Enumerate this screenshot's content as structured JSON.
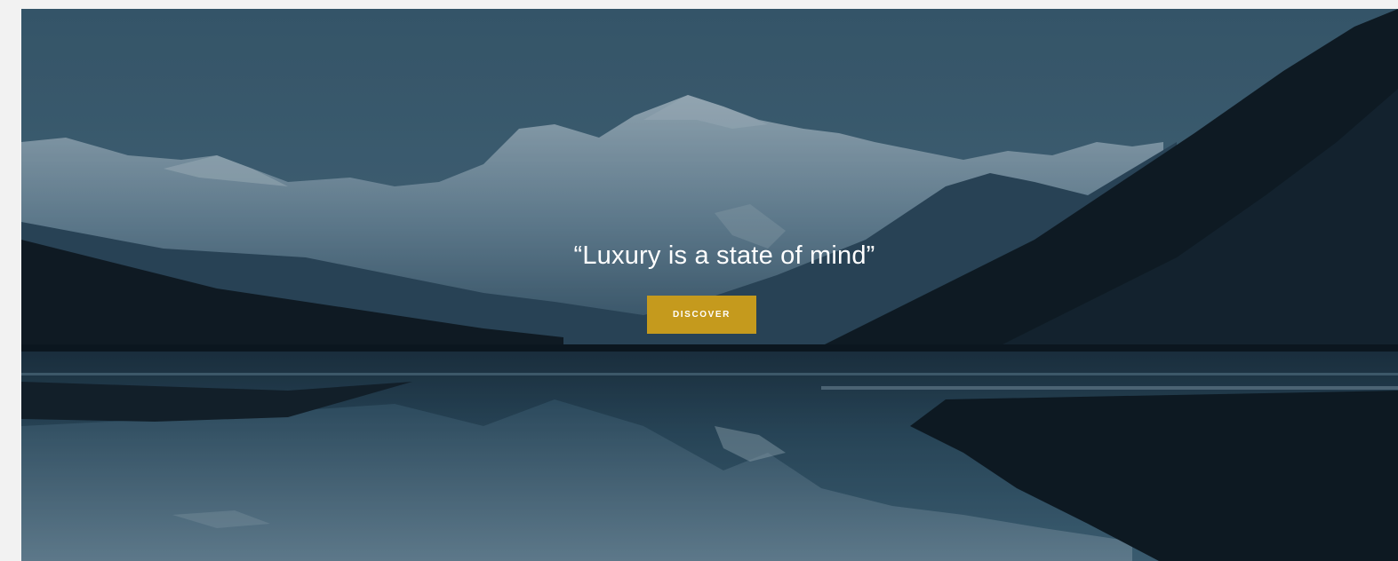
{
  "hero": {
    "quote": "“Luxury is a state of mind”",
    "cta_label": "DISCOVER",
    "background_image": "mountain-lake-landscape",
    "accent_color": "#c59a1d"
  }
}
